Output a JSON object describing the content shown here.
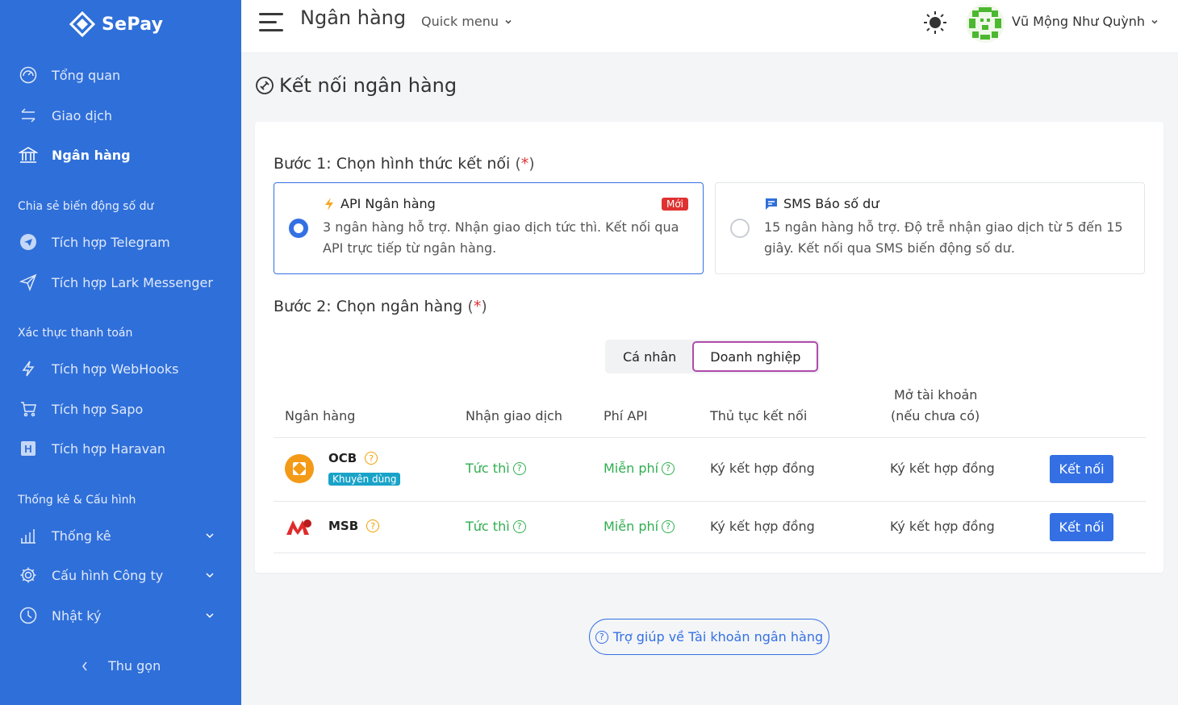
{
  "sidebar": {
    "brand": "SePay",
    "nav": [
      {
        "label": "Tổng quan",
        "icon": "dashboard-icon"
      },
      {
        "label": "Giao dịch",
        "icon": "transactions-icon"
      },
      {
        "label": "Ngân hàng",
        "icon": "bank-icon"
      }
    ],
    "section_share": "Chia sẻ biến động số dư",
    "share_items": [
      {
        "label": "Tích hợp Telegram",
        "icon": "telegram-icon"
      },
      {
        "label": "Tích hợp Lark Messenger",
        "icon": "send-icon"
      }
    ],
    "section_verify": "Xác thực thanh toán",
    "verify_items": [
      {
        "label": "Tích hợp WebHooks",
        "icon": "lightning-icon"
      },
      {
        "label": "Tích hợp Sapo",
        "icon": "cart-icon"
      },
      {
        "label": "Tích hợp Haravan",
        "icon": "haravan-icon"
      }
    ],
    "section_stats": "Thống kê & Cấu hình",
    "stats_items": [
      {
        "label": "Thống kê",
        "icon": "chart-icon"
      },
      {
        "label": "Cấu hình Công ty",
        "icon": "gear-icon"
      },
      {
        "label": "Nhật ký",
        "icon": "clock-icon"
      }
    ],
    "collapse_label": "Thu gọn"
  },
  "topbar": {
    "title": "Ngân hàng",
    "quick_menu": "Quick menu",
    "user_name": "Vũ Mộng Như Quỳnh"
  },
  "content": {
    "title": "Kết nối ngân hàng",
    "step1": {
      "title": "Bước 1: Chọn hình thức kết nối",
      "required_mark": "*",
      "options": [
        {
          "title": "API Ngân hàng",
          "badge": "Mới",
          "desc": "3 ngân hàng hỗ trợ. Nhận giao dịch tức thì. Kết nối qua API trực tiếp từ ngân hàng.",
          "selected": true
        },
        {
          "title": "SMS Báo số dư",
          "desc": "15 ngân hàng hỗ trợ. Độ trễ nhận giao dịch từ 5 đến 15 giây. Kết nối qua SMS biến động số dư.",
          "selected": false
        }
      ]
    },
    "step2": {
      "title": "Bước 2: Chọn ngân hàng",
      "required_mark": "*",
      "toggle": [
        "Cá nhân",
        "Doanh nghiệp"
      ],
      "toggle_selected": "Doanh nghiệp"
    },
    "table": {
      "headers": {
        "bank": "Ngân hàng",
        "receive": "Nhận giao dịch",
        "fee": "Phí API",
        "procedure": "Thủ tục kết nối",
        "open_line1": "Mở tài khoản",
        "open_line2": "(nếu chưa có)"
      },
      "rows": [
        {
          "name": "OCB",
          "tag": "Khuyên dùng",
          "receive": "Tức thì",
          "fee": "Miễn phí",
          "procedure": "Ký kết hợp đồng",
          "open": "Ký kết hợp đồng",
          "action": "Kết nối"
        },
        {
          "name": "MSB",
          "receive": "Tức thì",
          "fee": "Miễn phí",
          "procedure": "Ký kết hợp đồng",
          "open": "Ký kết hợp đồng",
          "action": "Kết nối"
        }
      ]
    },
    "help_button": "Trợ giúp về Tài khoản ngân hàng"
  },
  "colors": {
    "sidebar_bg": "#2f6fd9",
    "primary": "#3470e4",
    "success": "#2fae4f",
    "danger": "#e03131",
    "accent_toggle": "#b04ba9"
  }
}
